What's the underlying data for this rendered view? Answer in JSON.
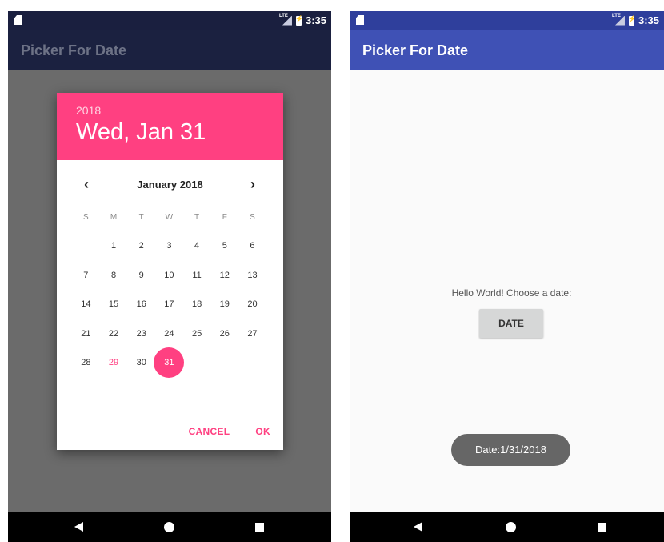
{
  "left_screen": {
    "status": {
      "time": "3:35",
      "network": "LTE"
    },
    "app_title": "Picker For Date",
    "dialog": {
      "year": "2018",
      "date_heading": "Wed, Jan 31",
      "month_label": "January 2018",
      "prev_icon": "‹",
      "next_icon": "›",
      "weekdays": [
        "S",
        "M",
        "T",
        "W",
        "T",
        "F",
        "S"
      ],
      "days": [
        "",
        "1",
        "2",
        "3",
        "4",
        "5",
        "6",
        "7",
        "8",
        "9",
        "10",
        "11",
        "12",
        "13",
        "14",
        "15",
        "16",
        "17",
        "18",
        "19",
        "20",
        "21",
        "22",
        "23",
        "24",
        "25",
        "26",
        "27",
        "28",
        "29",
        "30",
        "31"
      ],
      "today": "29",
      "selected": "31",
      "cancel_label": "CANCEL",
      "ok_label": "OK"
    }
  },
  "right_screen": {
    "status": {
      "time": "3:35",
      "network": "LTE"
    },
    "app_title": "Picker For Date",
    "hello_text": "Hello World! Choose a date:",
    "date_button_label": "DATE",
    "toast_text": "Date:1/31/2018"
  },
  "colors": {
    "accent": "#ff4081",
    "primary": "#3f51b5",
    "primary_dark": "#303f9f"
  }
}
